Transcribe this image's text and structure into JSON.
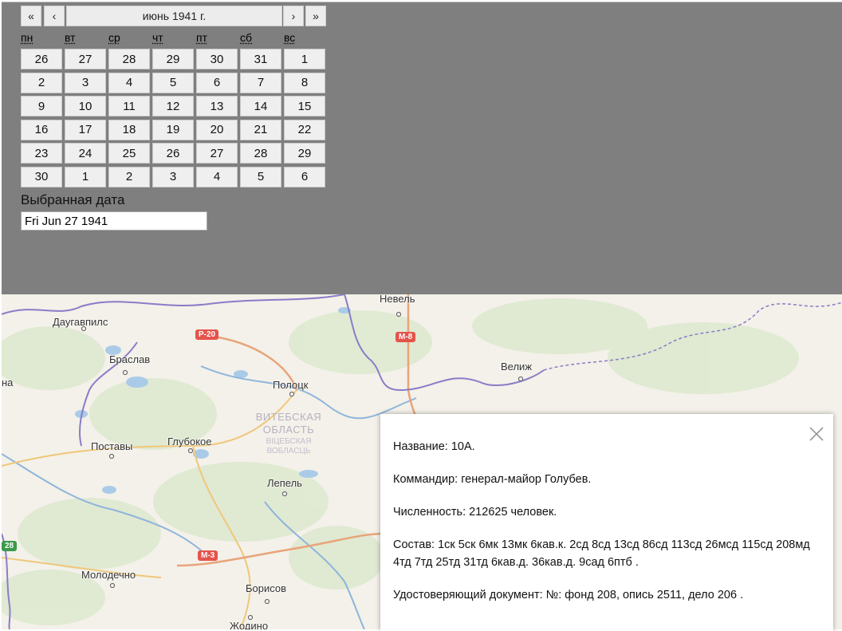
{
  "calendar": {
    "nav": {
      "prev_year": "«",
      "prev_month": "‹",
      "title": "июнь 1941 г.",
      "next_month": "›",
      "next_year": "»"
    },
    "weekdays": [
      "пн",
      "вт",
      "ср",
      "чт",
      "пт",
      "сб",
      "вс"
    ],
    "weeks": [
      [
        "26",
        "27",
        "28",
        "29",
        "30",
        "31",
        "1"
      ],
      [
        "2",
        "3",
        "4",
        "5",
        "6",
        "7",
        "8"
      ],
      [
        "9",
        "10",
        "11",
        "12",
        "13",
        "14",
        "15"
      ],
      [
        "16",
        "17",
        "18",
        "19",
        "20",
        "21",
        "22"
      ],
      [
        "23",
        "24",
        "25",
        "26",
        "27",
        "28",
        "29"
      ],
      [
        "30",
        "1",
        "2",
        "3",
        "4",
        "5",
        "6"
      ]
    ],
    "selected_label": "Выбранная дата",
    "selected_value": "Fri Jun 27 1941"
  },
  "map": {
    "cities": [
      "Невель",
      "Даугавпилс",
      "Браслав",
      "Велиж",
      "Полоцк",
      "Поставы",
      "Глубокое",
      "Лепель",
      "Молодечно",
      "Борисов",
      "Жодино"
    ],
    "region": {
      "name_ru_1": "ВИТЕБСКАЯ",
      "name_ru_2": "ОБЛАСТЬ",
      "name_by_1": "ВІЦЕБСКАЯ",
      "name_by_2": "ВОБЛАСЦЬ"
    },
    "roads": [
      "Р-20",
      "М-8",
      "М-3",
      "28"
    ],
    "edge_label": "на"
  },
  "popup": {
    "name": "Название: 10А.",
    "commander": "Коммандир: генерал-майор Голубев.",
    "strength": "Численность: 212625 человек.",
    "composition": "Состав: 1ск 5ск 6мк 13мк 6кав.к. 2сд 8сд 13сд 86сд 113сд 26мсд 115сд 208мд 4тд 7тд 25тд 31тд 6кав.д. 36кав.д. 9сад 6птб .",
    "document": "Удостоверяющий документ: №: фонд 208, опись 2511, дело 206 ."
  }
}
